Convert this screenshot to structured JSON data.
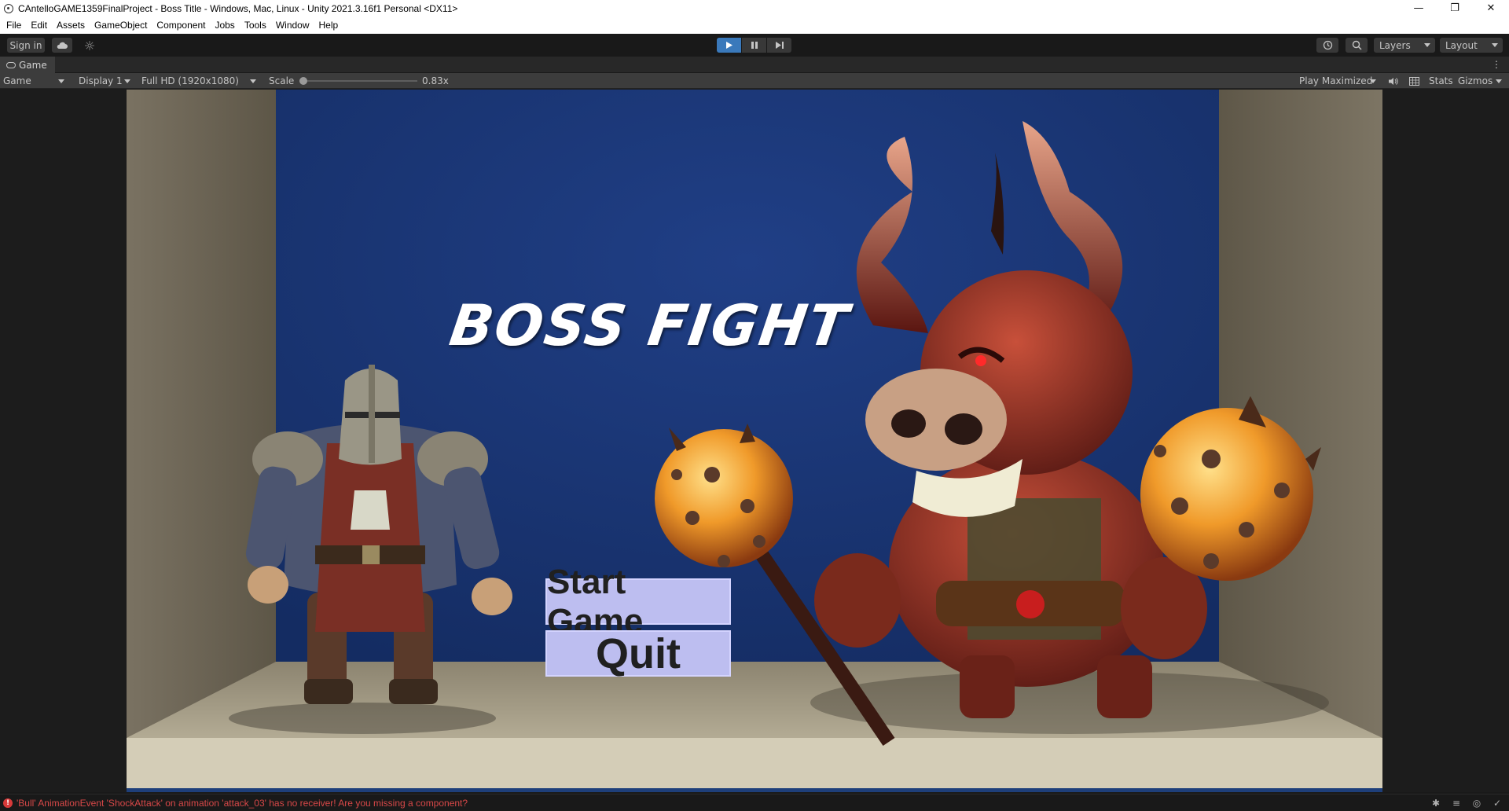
{
  "window": {
    "title": "CAntelloGAME1359FinalProject - Boss Title - Windows, Mac, Linux - Unity 2021.3.16f1 Personal <DX11>",
    "controls": {
      "minimize": "—",
      "restore": "❐",
      "close": "✕"
    }
  },
  "menubar": {
    "items": [
      "File",
      "Edit",
      "Assets",
      "GameObject",
      "Component",
      "Jobs",
      "Tools",
      "Window",
      "Help"
    ]
  },
  "toolbar": {
    "sign_in": "Sign in",
    "play_state": "playing",
    "layers": "Layers",
    "layout": "Layout"
  },
  "tab": {
    "label": "Game"
  },
  "gamebar": {
    "view": "Game",
    "display": "Display 1",
    "resolution": "Full HD (1920x1080)",
    "scale_label": "Scale",
    "scale_value": "0.83x",
    "scale_slider": 0.0,
    "play_mode": "Play Maximized",
    "stats": "Stats",
    "gizmos": "Gizmos"
  },
  "game": {
    "title": "BOSS FIGHT",
    "start_button": "Start Game",
    "quit_button": "Quit"
  },
  "status": {
    "message": "'Bull' AnimationEvent 'ShockAttack' on animation 'attack_03' has no receiver! Are you missing a component?",
    "level": "error"
  },
  "colors": {
    "editor_bg": "#191919",
    "play_active": "#3a79bb",
    "backdrop_blue": "#1a3a7c",
    "button_fill": "#bdbef0",
    "error_text": "#d84848"
  }
}
